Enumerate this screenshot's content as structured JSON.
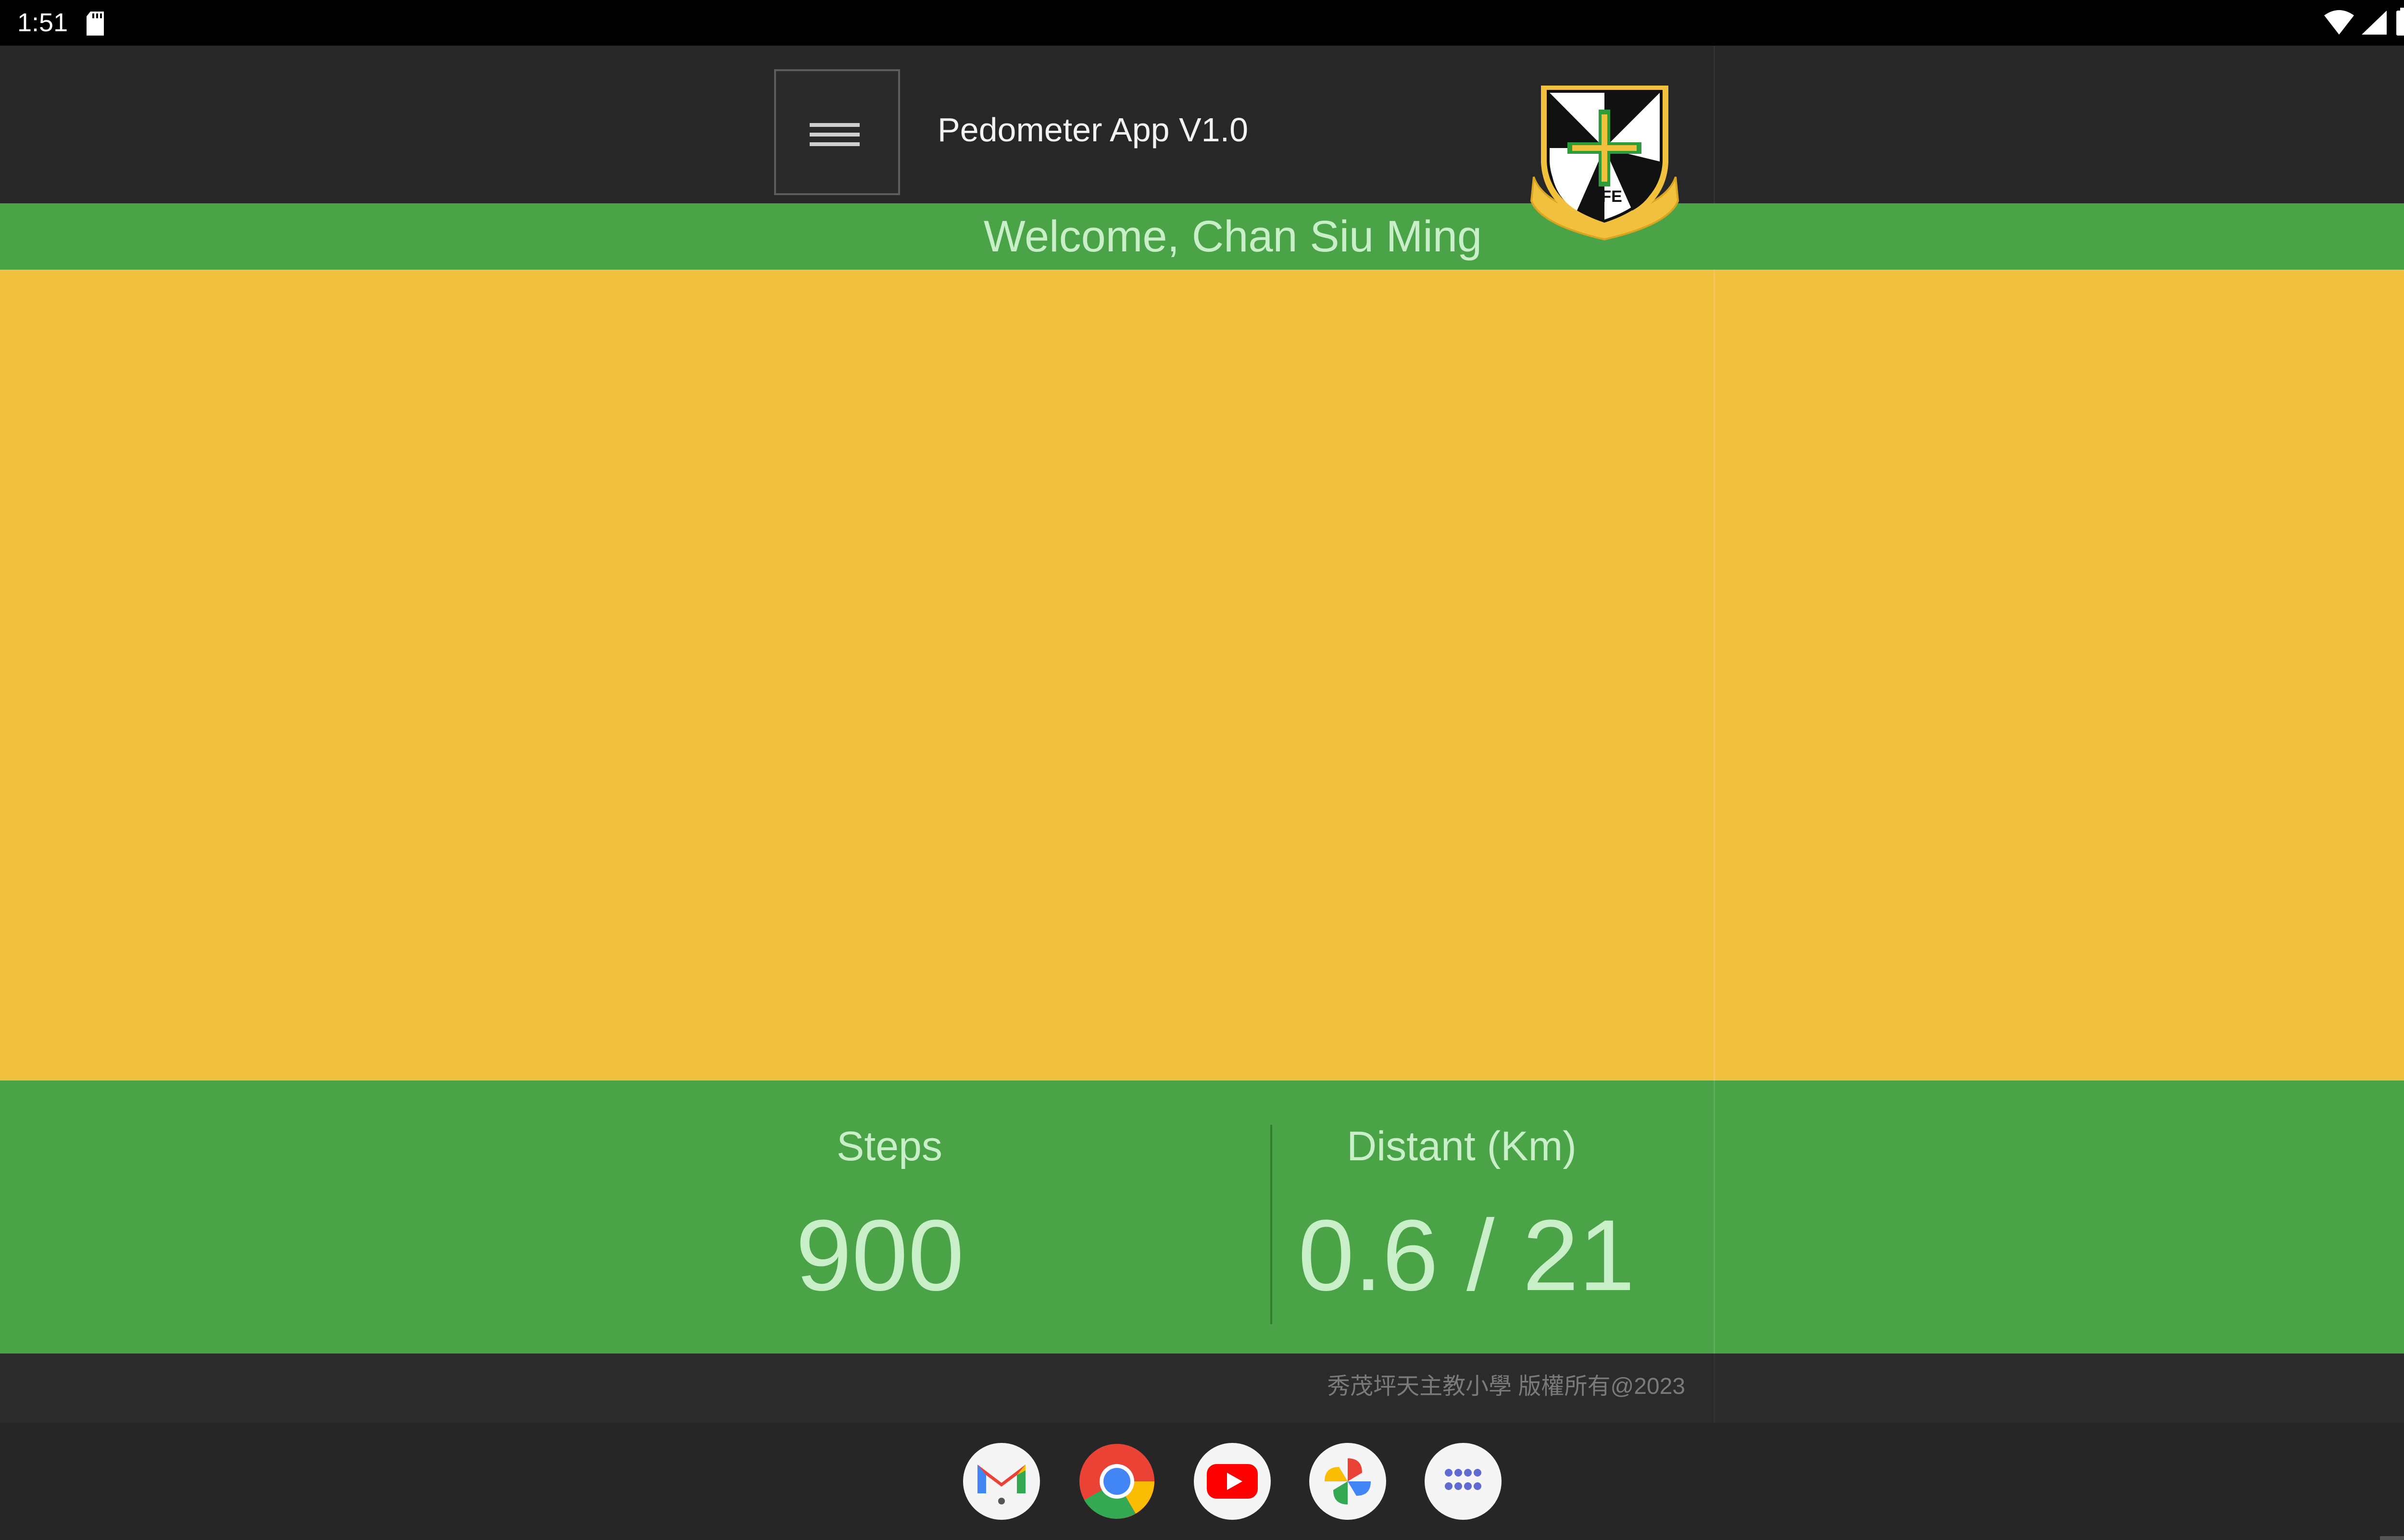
{
  "status_bar": {
    "time": "1:51",
    "icons": [
      "sd-card-icon",
      "wifi-icon",
      "cell-signal-icon",
      "battery-icon"
    ]
  },
  "header": {
    "menu_icon": "hamburger-menu-icon",
    "title": "Pedometer App V1.0",
    "logo": "school-crest-logo",
    "logo_text": "LIFE"
  },
  "welcome": {
    "text": "Welcome, Chan Siu Ming"
  },
  "stats": {
    "steps_label": "Steps",
    "steps_value": "900",
    "distance_label": "Distant (Km)",
    "distance_value": "0.6 / 21"
  },
  "footer": {
    "copyright": "秀茂坪天主教小學 版權所有@2023"
  },
  "dock": {
    "apps": [
      "gmail-icon",
      "chrome-icon",
      "youtube-icon",
      "photos-icon",
      "app-drawer-icon"
    ]
  },
  "colors": {
    "green": "#4aa447",
    "yellow": "#f1c03d",
    "dark": "#272727",
    "light_green_text": "#c9efc9"
  }
}
